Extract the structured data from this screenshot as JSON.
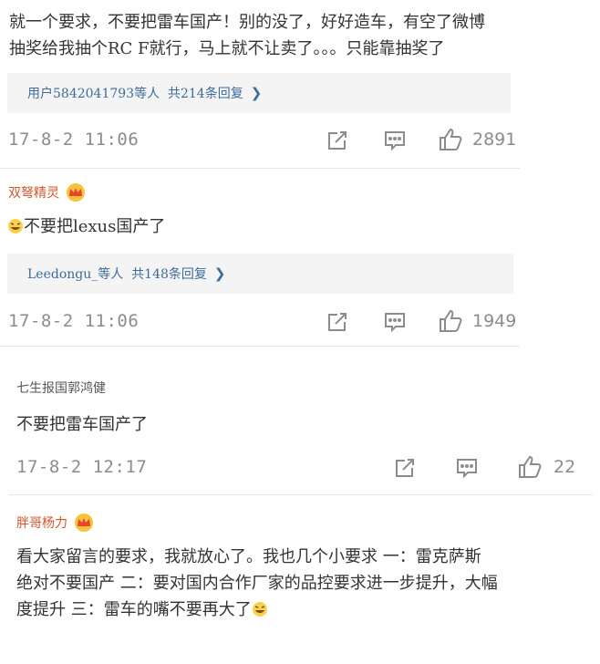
{
  "comments": [
    {
      "text_line1": "就一个要求，不要把雷车国产！别的没了，好好造车，有空了微博",
      "text_line2": "抽奖给我抽个RC F就行，马上就不让卖了。。。只能靠抽奖了",
      "replies_label": "用户5842041793等人",
      "replies_count": "共214条回复",
      "time": "17-8-2 11:06",
      "likes": "2891"
    },
    {
      "user": "双弩精灵",
      "text": "不要把lexus国产了",
      "replies_label": "Leedongu_等人",
      "replies_count": "共148条回复",
      "time": "17-8-2 11:06",
      "likes": "1949"
    },
    {
      "user": "七生报国郭鸿健",
      "text": "不要把雷车国产了",
      "time": "17-8-2 12:17",
      "likes": "22"
    },
    {
      "user": "胖哥杨力",
      "text_line1": "看大家留言的要求，我就放心了。我也几个小要求 一：雷克萨斯",
      "text_line2": "绝对不要国产 二：要对国内合作厂家的品控要求进一步提升，大幅",
      "text_line3": "度提升 三：雷车的嘴不要再大了"
    }
  ],
  "colors": {
    "username": "#d6552a",
    "link": "#3d6c9a",
    "meta": "#8c8c8c"
  }
}
